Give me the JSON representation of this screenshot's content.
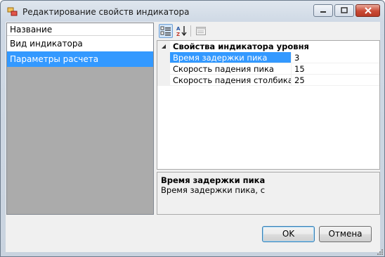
{
  "window": {
    "title": "Редактирование свойств индикатора",
    "accent_color": "#3399ff",
    "icon": "app-window-icon"
  },
  "list": {
    "header": "Название",
    "items": [
      {
        "label": "Вид индикатора",
        "selected": false
      },
      {
        "label": "Параметры расчета",
        "selected": true
      }
    ]
  },
  "toolbar": {
    "categorized_icon": "categorized-icon",
    "alphabetical_icon": "sort-az-icon",
    "property_pages_icon": "property-pages-icon"
  },
  "grid": {
    "category": "Свойства индикатора уровня",
    "properties": [
      {
        "name": "Время задержки пика",
        "value": "3",
        "selected": true
      },
      {
        "name": "Скорость падения пика",
        "value": "15",
        "selected": false
      },
      {
        "name": "Скорость падения столбика",
        "value": "25",
        "selected": false
      }
    ]
  },
  "help": {
    "title": "Время задержки пика",
    "description": "Время задержки пика, с"
  },
  "buttons": {
    "ok": "OK",
    "cancel": "Отмена"
  }
}
